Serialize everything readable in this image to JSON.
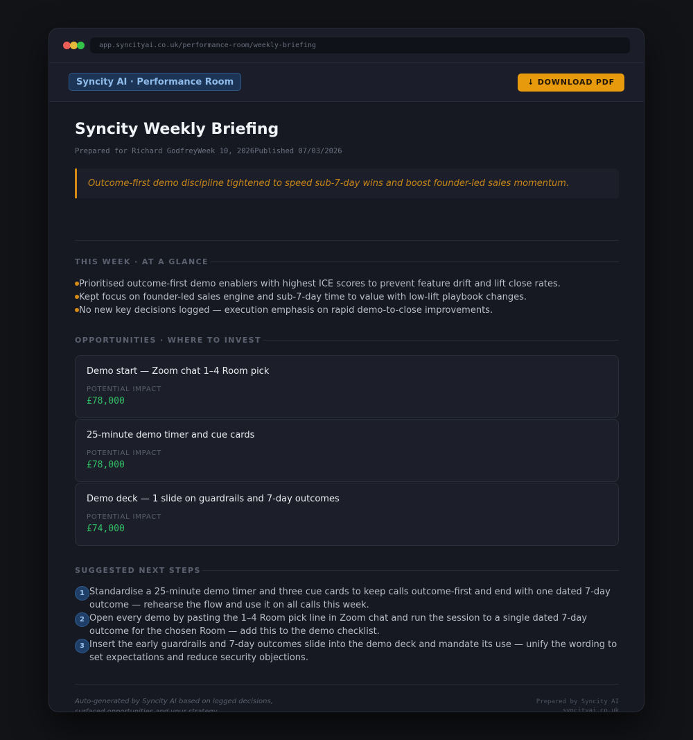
{
  "browser": {
    "url": "app.syncityai.co.uk/performance-room/weekly-briefing"
  },
  "appbar": {
    "brand_label": "Syncity AI · Performance Room",
    "download_label": "↓ DOWNLOAD PDF",
    "accent_color": "#e69a0c"
  },
  "briefing": {
    "title": "Syncity Weekly Briefing",
    "prepared_for": "Prepared for Richard Godfrey",
    "week": "Week 10, 2026",
    "published": "Published 07/03/2026",
    "summary": "Outcome-first demo discipline tightened to speed sub-7-day wins and boost founder-led sales momentum."
  },
  "at_a_glance": {
    "heading": "THIS WEEK · AT A GLANCE",
    "items": [
      "Prioritised outcome-first demo enablers with highest ICE scores to prevent feature drift and lift close rates.",
      "Kept focus on founder-led sales engine and sub-7-day time to value with low-lift playbook changes.",
      "No new key decisions logged — execution emphasis on rapid demo-to-close improvements."
    ]
  },
  "opportunities": {
    "heading": "OPPORTUNITIES · WHERE TO INVEST",
    "impact_label": "POTENTIAL IMPACT",
    "items": [
      {
        "title": "Demo start — Zoom chat 1–4 Room pick",
        "impact": "£78,000"
      },
      {
        "title": "25-minute demo timer and cue cards",
        "impact": "£78,000"
      },
      {
        "title": "Demo deck — 1 slide on guardrails and 7-day outcomes",
        "impact": "£74,000"
      }
    ]
  },
  "next_steps": {
    "heading": "SUGGESTED NEXT STEPS",
    "items": [
      {
        "number": "1",
        "text": "Standardise a 25-minute demo timer and three cue cards to keep calls outcome-first and end with one dated 7-day outcome — rehearse the flow and use it on all calls this week."
      },
      {
        "number": "2",
        "text": "Open every demo by pasting the 1–4 Room pick line in Zoom chat and run the session to a single dated 7-day outcome for the chosen Room — add this to the demo checklist."
      },
      {
        "number": "3",
        "text": "Insert the early guardrails and 7-day outcomes slide into the demo deck and mandate its use — unify the wording to set expectations and reduce security objections."
      }
    ]
  },
  "footer": {
    "note_line1": "Auto-generated by Syncity AI based on logged decisions,",
    "note_line2": "surfaced opportunities and your strategy.",
    "prepared_by": "Prepared by Syncity AI",
    "domain": "syncityai.co.uk"
  }
}
